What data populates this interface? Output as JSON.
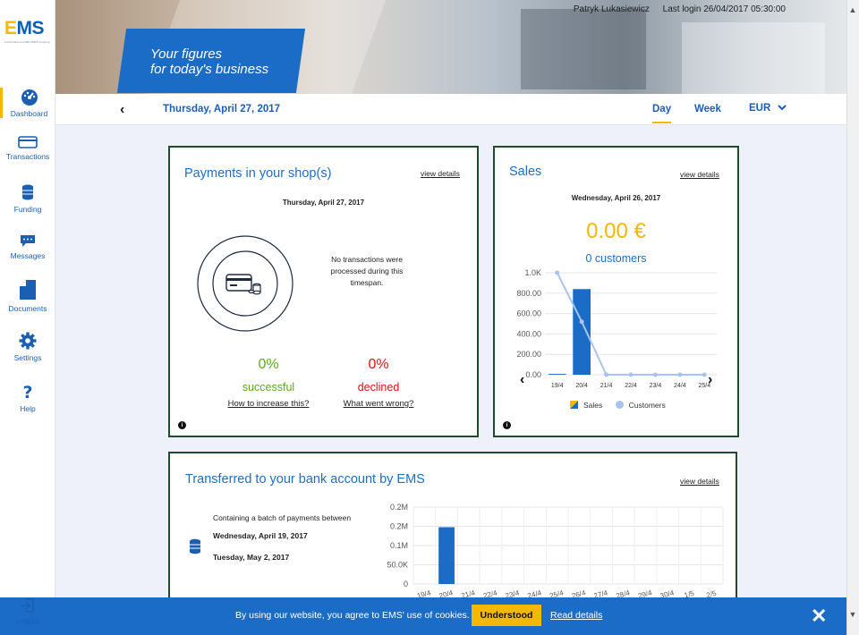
{
  "app": {
    "logo_text_e": "E",
    "logo_text_ms": "MS",
    "logo_sub": "A First Data and ABN AMRO company"
  },
  "sidebar": {
    "items": [
      {
        "label": "Dashboard",
        "icon": "speedometer-icon"
      },
      {
        "label": "Transactions",
        "icon": "card-icon"
      },
      {
        "label": "Funding",
        "icon": "coins-icon"
      },
      {
        "label": "Messages",
        "icon": "chat-icon"
      },
      {
        "label": "Documents",
        "icon": "document-icon"
      },
      {
        "label": "Settings",
        "icon": "gear-icon"
      },
      {
        "label": "Help",
        "icon": "question-icon"
      }
    ],
    "logout_label": "Logout"
  },
  "hero": {
    "tagline_line1": "Your figures",
    "tagline_line2": "for today's business",
    "user_name": "Patryk Lukasiewicz",
    "last_login": "Last login 26/04/2017 05:30:00"
  },
  "datebar": {
    "prev_icon": "chevron-left-icon",
    "current_date": "Thursday, April 27, 2017",
    "tabs": [
      {
        "label": "Day",
        "active": true
      },
      {
        "label": "Week",
        "active": false
      }
    ],
    "currency": "EUR"
  },
  "payments_card": {
    "title": "Payments in your shop(s)",
    "view_details": "view details",
    "date": "Thursday, April 27, 2017",
    "no_transactions": "No transactions were processed during this timespan.",
    "successful_pct": "0%",
    "successful_label": "successful",
    "successful_link": "How to increase this?",
    "declined_pct": "0%",
    "declined_label": "declined",
    "declined_link": "What went wrong?",
    "colors": {
      "successful": "#5aaa1e",
      "declined": "#e01010"
    }
  },
  "sales_card": {
    "title": "Sales",
    "view_details": "view details",
    "date": "Wednesday, April 26, 2017",
    "amount": "0.00 €",
    "customers": "0 customers",
    "legend_sales": "Sales",
    "legend_customers": "Customers"
  },
  "transfer_card": {
    "title": "Transferred to your bank account by EMS",
    "view_details": "view details",
    "batch_text": "Containing a batch of payments between",
    "batch_start": "Wednesday, April 19, 2017",
    "batch_end": "Tuesday, May 2, 2017"
  },
  "cookie": {
    "text": "By using our website, you agree to EMS' use of cookies.",
    "button": "Understood",
    "link": "Read details"
  },
  "chart_data": [
    {
      "type": "bar",
      "categories": [
        "19/4",
        "20/4",
        "21/4",
        "22/4",
        "23/4",
        "24/4",
        "25/4"
      ],
      "ytick_labels": [
        "0.00",
        "200.00",
        "400.00",
        "600.00",
        "800.00",
        "1.0K"
      ],
      "ylim": [
        0,
        1000
      ],
      "series": [
        {
          "name": "Sales",
          "type": "bar",
          "values": [
            8,
            840,
            0,
            0,
            0,
            0,
            0
          ]
        },
        {
          "name": "Customers",
          "type": "line",
          "values": [
            1000,
            520,
            0,
            0,
            0,
            0,
            0
          ]
        }
      ]
    },
    {
      "type": "bar",
      "categories": [
        "19/4",
        "20/4",
        "21/4",
        "22/4",
        "23/4",
        "24/4",
        "25/4",
        "26/4",
        "27/4",
        "28/4",
        "29/4",
        "30/4",
        "1/5",
        "2/5"
      ],
      "ytick_labels": [
        "0",
        "50.0K",
        "0.1M",
        "0.2M",
        "0.2M"
      ],
      "ylim": [
        0,
        230000
      ],
      "series": [
        {
          "values": [
            0,
            170000,
            0,
            0,
            0,
            0,
            0,
            0,
            0,
            0,
            0,
            0,
            0,
            0
          ]
        }
      ]
    }
  ]
}
